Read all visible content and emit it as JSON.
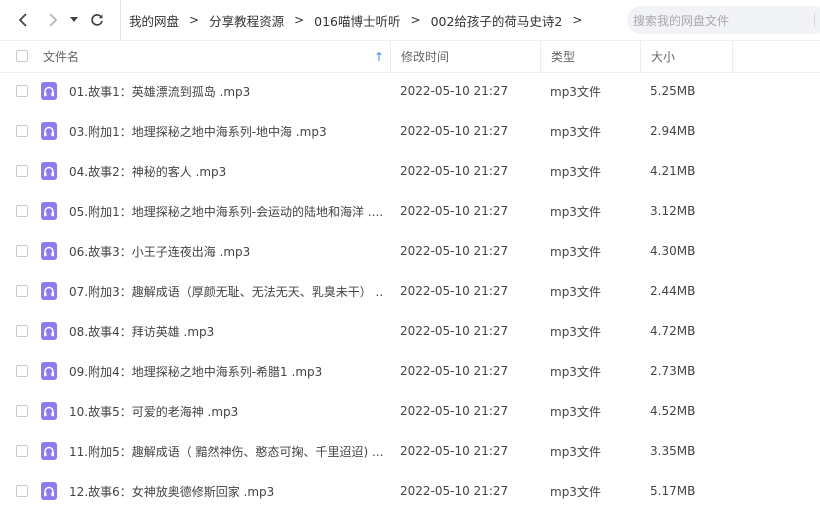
{
  "nav": {
    "back_glyph": "‹",
    "forward_glyph": "›",
    "dropdown_glyph": "▾",
    "refresh_glyph": "↻"
  },
  "breadcrumbs": [
    "我的网盘",
    "分享教程资源",
    "016喵博士听听",
    "002给孩子的荷马史诗2"
  ],
  "breadcrumb_separator": ">",
  "search": {
    "placeholder": "搜索我的网盘文件"
  },
  "columns": {
    "name": "文件名",
    "sort_arrow": "↑",
    "modified": "修改时间",
    "type": "类型",
    "size": "大小"
  },
  "colors": {
    "accent": "#3a8cff",
    "icon": "#8b7dee"
  },
  "files": [
    {
      "name": "01.故事1：英雄漂流到孤岛 .mp3",
      "modified": "2022-05-10 21:27",
      "type": "mp3文件",
      "size": "5.25MB",
      "icon": "audio-file-icon"
    },
    {
      "name": "03.附加1：地理探秘之地中海系列-地中海 .mp3",
      "modified": "2022-05-10 21:27",
      "type": "mp3文件",
      "size": "2.94MB",
      "icon": "audio-file-icon"
    },
    {
      "name": "04.故事2：神秘的客人 .mp3",
      "modified": "2022-05-10 21:27",
      "type": "mp3文件",
      "size": "4.21MB",
      "icon": "audio-file-icon"
    },
    {
      "name": "05.附加1：地理探秘之地中海系列-会运动的陆地和海洋 ....",
      "modified": "2022-05-10 21:27",
      "type": "mp3文件",
      "size": "3.12MB",
      "icon": "audio-file-icon"
    },
    {
      "name": "06.故事3：小王子连夜出海 .mp3",
      "modified": "2022-05-10 21:27",
      "type": "mp3文件",
      "size": "4.30MB",
      "icon": "audio-file-icon"
    },
    {
      "name": "07.附加3：趣解成语（厚颜无耻、无法无天、乳臭未干） ...",
      "modified": "2022-05-10 21:27",
      "type": "mp3文件",
      "size": "2.44MB",
      "icon": "audio-file-icon"
    },
    {
      "name": "08.故事4：拜访英雄 .mp3",
      "modified": "2022-05-10 21:27",
      "type": "mp3文件",
      "size": "4.72MB",
      "icon": "audio-file-icon"
    },
    {
      "name": "09.附加4：地理探秘之地中海系列-希腊1 .mp3",
      "modified": "2022-05-10 21:27",
      "type": "mp3文件",
      "size": "2.73MB",
      "icon": "audio-file-icon"
    },
    {
      "name": "10.故事5：可爱的老海神 .mp3",
      "modified": "2022-05-10 21:27",
      "type": "mp3文件",
      "size": "4.52MB",
      "icon": "audio-file-icon"
    },
    {
      "name": "11.附加5：趣解成语（ 黯然神伤、憨态可掬、千里迢迢) ....",
      "modified": "2022-05-10 21:27",
      "type": "mp3文件",
      "size": "3.35MB",
      "icon": "audio-file-icon"
    },
    {
      "name": "12.故事6：女神放奥德修斯回家 .mp3",
      "modified": "2022-05-10 21:27",
      "type": "mp3文件",
      "size": "5.17MB",
      "icon": "audio-file-icon"
    }
  ]
}
